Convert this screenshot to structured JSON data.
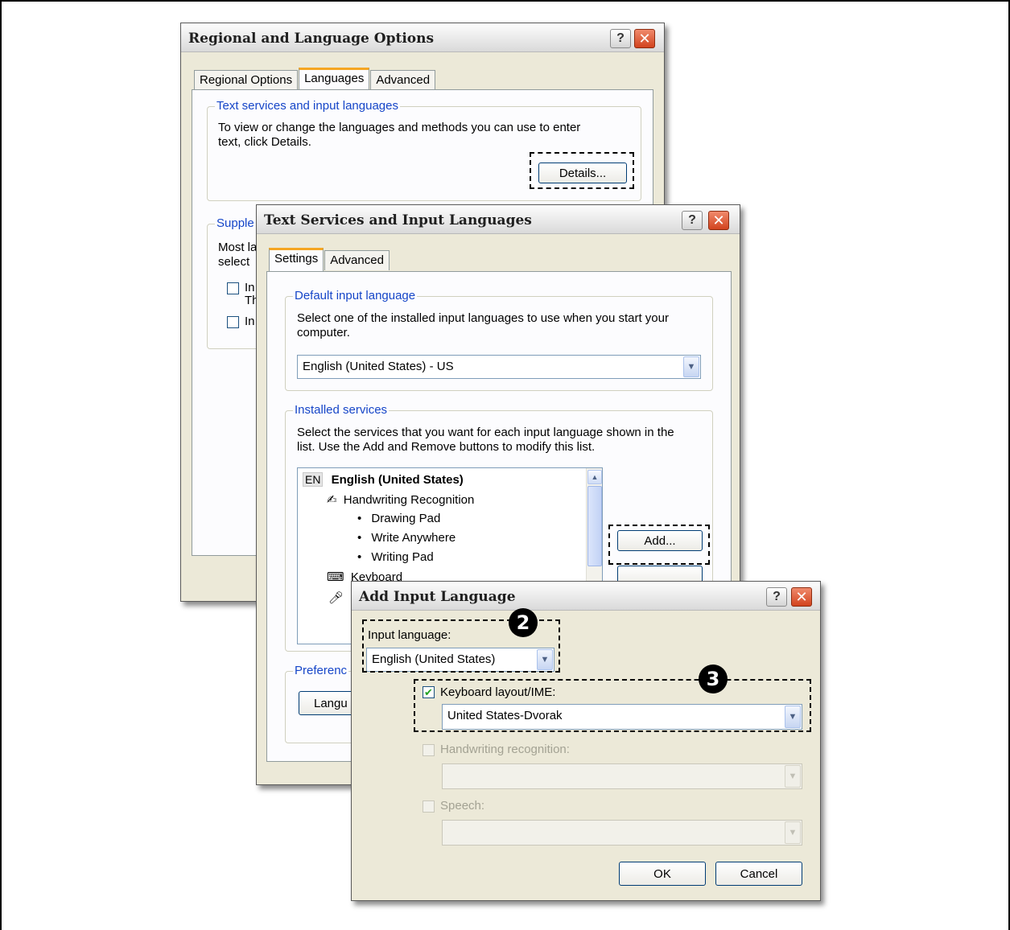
{
  "regional": {
    "title": "Regional and Language Options",
    "tabs": [
      "Regional Options",
      "Languages",
      "Advanced"
    ],
    "text_services_group": "Text services and input languages",
    "text_services_desc_1": "To view or change the languages and methods you can use to enter",
    "text_services_desc_2": "text, click Details.",
    "details_button": "Details...",
    "supplemental_group_partial": "Supple",
    "supplemental_desc_1_partial": "Most la",
    "supplemental_desc_2_partial": "select",
    "checkbox1_partial": "In",
    "checkbox1_line2_partial": "Th",
    "checkbox2_partial": "In"
  },
  "text_services": {
    "title": "Text Services and Input Languages",
    "tabs": [
      "Settings",
      "Advanced"
    ],
    "default_group": "Default input language",
    "default_desc_1": "Select one of the installed input languages to use when you start your",
    "default_desc_2": "computer.",
    "default_value": "English (United States) - US",
    "installed_group": "Installed services",
    "installed_desc_1": "Select the services that you want for each input language shown in the",
    "installed_desc_2": "list. Use the Add and Remove buttons to modify this list.",
    "list": {
      "lang_code": "EN",
      "language": "English (United States)",
      "handwriting": "Handwriting Recognition",
      "hw_items": [
        "Drawing Pad",
        "Write Anywhere",
        "Writing Pad"
      ],
      "keyboard": "Keyboard"
    },
    "add_button": "Add...",
    "preferences_partial": "Preferenc",
    "language_bar_partial": "Langu"
  },
  "add_input": {
    "title": "Add Input Language",
    "input_language_label": "Input language:",
    "input_language_value": "English (United States)",
    "keyboard_label": "Keyboard layout/IME:",
    "keyboard_checked": true,
    "keyboard_value": "United States-Dvorak",
    "handwriting_label": "Handwriting recognition:",
    "speech_label": "Speech:",
    "ok": "OK",
    "cancel": "Cancel"
  },
  "callouts": {
    "step2": "2",
    "step3": "3"
  }
}
